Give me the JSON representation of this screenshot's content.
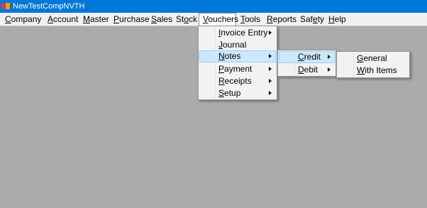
{
  "window": {
    "title": "NewTestCompNVTH"
  },
  "menubar": [
    {
      "id": "company",
      "pre": "",
      "key": "C",
      "post": "ompany"
    },
    {
      "id": "account",
      "pre": "",
      "key": "A",
      "post": "ccount"
    },
    {
      "id": "master",
      "pre": "",
      "key": "M",
      "post": "aster"
    },
    {
      "id": "purchase",
      "pre": "",
      "key": "P",
      "post": "urchase"
    },
    {
      "id": "sales",
      "pre": "",
      "key": "S",
      "post": "ales"
    },
    {
      "id": "stock",
      "pre": "St",
      "key": "o",
      "post": "ck"
    },
    {
      "id": "vouchers",
      "pre": "",
      "key": "V",
      "post": "ouchers"
    },
    {
      "id": "tools",
      "pre": "",
      "key": "T",
      "post": "ools"
    },
    {
      "id": "reports",
      "pre": "",
      "key": "R",
      "post": "eports"
    },
    {
      "id": "safety",
      "pre": "Saf",
      "key": "e",
      "post": "ty"
    },
    {
      "id": "help",
      "pre": "",
      "key": "H",
      "post": "elp"
    }
  ],
  "vouchers_menu": [
    {
      "id": "invoice-entry",
      "pre": "",
      "key": "I",
      "post": "nvoice Entry",
      "submenu": true
    },
    {
      "id": "journal",
      "pre": "",
      "key": "J",
      "post": "ournal",
      "submenu": false
    },
    {
      "id": "notes",
      "pre": "",
      "key": "N",
      "post": "otes",
      "submenu": true
    },
    {
      "id": "payment",
      "pre": "",
      "key": "P",
      "post": "ayment",
      "submenu": true
    },
    {
      "id": "receipts",
      "pre": "",
      "key": "R",
      "post": "eceipts",
      "submenu": true
    },
    {
      "id": "setup",
      "pre": "",
      "key": "S",
      "post": "etup",
      "submenu": true
    }
  ],
  "notes_menu": [
    {
      "id": "credit",
      "pre": "",
      "key": "C",
      "post": "redit",
      "submenu": true
    },
    {
      "id": "debit",
      "pre": "",
      "key": "D",
      "post": "ebit",
      "submenu": true
    }
  ],
  "credit_menu": [
    {
      "id": "general",
      "pre": "",
      "key": "G",
      "post": "eneral"
    },
    {
      "id": "with-items",
      "pre": "",
      "key": "W",
      "post": "ith Items"
    }
  ]
}
